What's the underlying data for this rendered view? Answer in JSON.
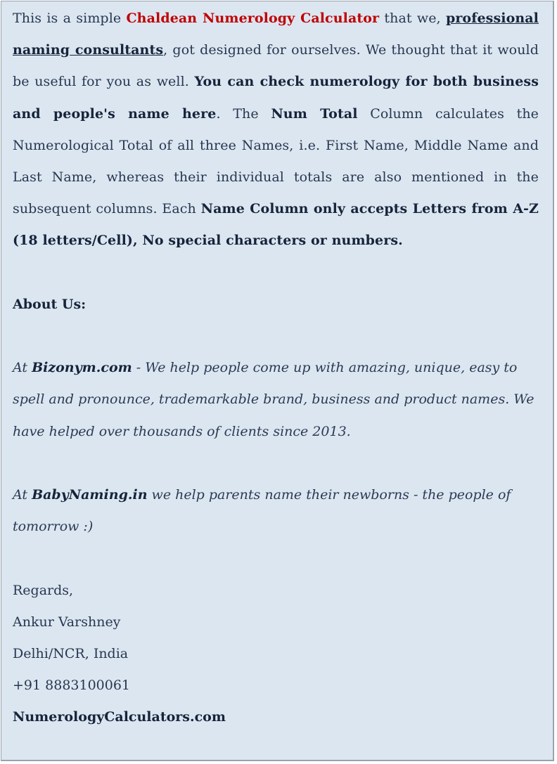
{
  "intro": {
    "t1": "This is a simple ",
    "calculator_name": "Chaldean Numerology Calculator",
    "t2": " that we, ",
    "consultants_link": "professional naming consultants",
    "t3": ", got designed for ourselves. We thought that it would be useful for you as well. ",
    "bold_check": "You can check numerology for both business and people's name here",
    "t4": ". The ",
    "bold_num_total": "Num Total",
    "t5": " Column calculates the Numerological Total of all three Names, i.e. First Name, Middle Name and Last Name, whereas their individual totals are also mentioned in the subsequent columns. Each ",
    "bold_rule": "Name Column only accepts Letters from A-Z (18 letters/Cell), No special characters or numbers."
  },
  "about": {
    "heading": "About Us:"
  },
  "bizonym": {
    "prefix": "At ",
    "brand": "Bizonym.com",
    "text": " - We help people come up with amazing, unique, easy to spell and pronounce, trademarkable brand, business and product names. We have helped over thousands of clients since 2013."
  },
  "babynaming": {
    "prefix": "At ",
    "brand": "BabyNaming.in",
    "text": " we help parents name their newborns - the people of tomorrow :)"
  },
  "signature": {
    "regards": "Regards,",
    "name": "Ankur Varshney",
    "location": "Delhi/NCR, India",
    "phone": "+91 8883100061",
    "website": "NumerologyCalculators.com"
  },
  "colors": {
    "panel_background": "#dce6f1",
    "accent_red": "#c00000",
    "text_dark": "#16243a"
  }
}
